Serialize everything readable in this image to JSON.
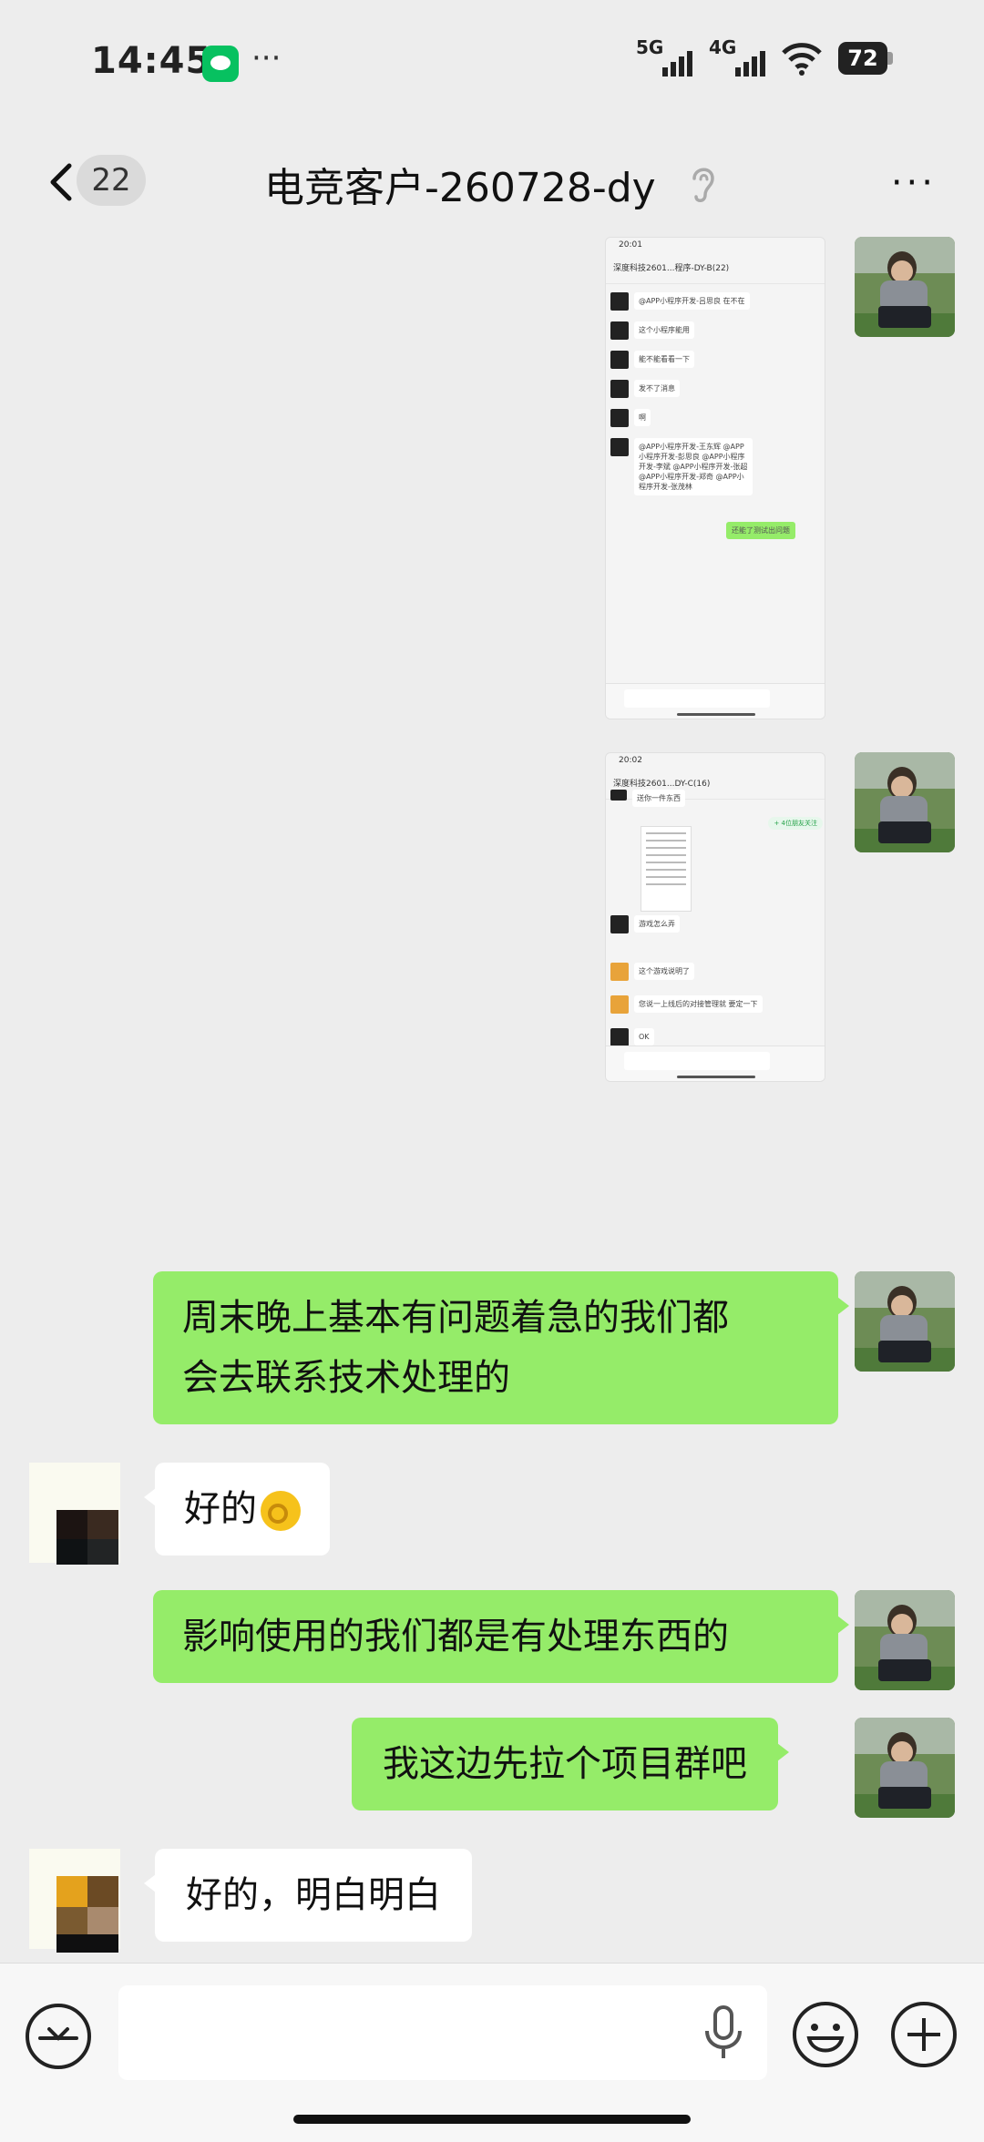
{
  "status_bar": {
    "time": "14:45",
    "more": "···",
    "signal_1_label": "5G",
    "signal_2_label": "4G",
    "battery": "72",
    "icons": [
      "wechat-icon",
      "signal-icon",
      "wifi-icon",
      "battery-icon"
    ]
  },
  "nav": {
    "back_icon": "chevron-left-icon",
    "unread_count": "22",
    "title": "电竞客户-260728-dy",
    "ear_icon": "ear-icon",
    "more": "···"
  },
  "messages": [
    {
      "side": "me",
      "type": "image",
      "desc_icon": "screenshot"
    },
    {
      "side": "me",
      "type": "image",
      "desc_icon": "screenshot"
    },
    {
      "side": "me",
      "type": "text",
      "text_line1": "周末晚上基本有问题着急的我们都",
      "text_line2": "会去联系技术处理的"
    },
    {
      "side": "them",
      "type": "text",
      "text": "好的"
    },
    {
      "side": "me",
      "type": "text",
      "text": "影响使用的我们都是有处理东西的"
    },
    {
      "side": "me",
      "type": "text",
      "text": "我这边先拉个项目群吧"
    },
    {
      "side": "them",
      "type": "text",
      "text": "好的，明白明白"
    }
  ],
  "shot1": {
    "time": "20:01",
    "title": "深度科技2601...程序-DY-B(22)",
    "msgs": [
      "@APP小程序开发-吕思良 在不在",
      "这个小程序能用",
      "能不能看看一下",
      "发不了消息",
      "啊",
      "@APP小程序开发-王东辉 @APP小程序开发-彭思良 @APP小程序开发-李斌 @APP小程序开发-张超 @APP小程序开发-郑奇 @APP小程序开发-张茂林"
    ],
    "reply": "还能了测试出问题"
  },
  "shot2": {
    "time": "20:02",
    "title": "深度科技2601...DY-C(16)",
    "msgs": [
      "送你一件东西",
      "游戏怎么弄",
      "这个游戏说明了",
      "您说一上线后的对接管理就 要定一下",
      "OK"
    ],
    "tag": "+ 4位朋友关注"
  },
  "input_bar": {
    "voice_icon": "voice-icon",
    "mic_icon": "microphone-icon",
    "emoji_icon": "emoji-icon",
    "plus_icon": "plus-icon"
  },
  "colors": {
    "my_bubble": "#95ec69",
    "their_bubble": "#ffffff",
    "background": "#ededed"
  }
}
